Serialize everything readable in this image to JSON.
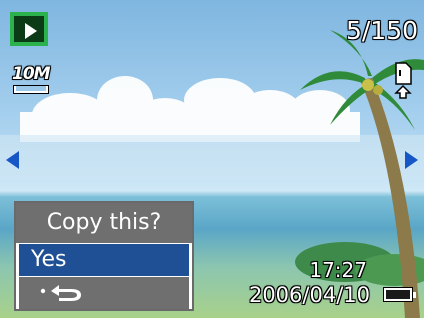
{
  "status": {
    "mode_icon": "play-mode-icon",
    "resolution_label": "10M",
    "counter": "5/150",
    "memory_icon": "internal-memory-icon",
    "time": "17:27",
    "date": "2006/04/10",
    "battery_icon": "battery-icon"
  },
  "nav": {
    "left_icon": "left-arrow-icon",
    "right_icon": "right-arrow-icon",
    "accent": "#1656c6"
  },
  "copy_menu": {
    "title": "Copy this?",
    "items": [
      {
        "label": "Yes",
        "selected": true
      },
      {
        "label": "",
        "icon": "back-icon",
        "selected": false
      }
    ],
    "selected_color": "#1f4f95",
    "panel_color": "#6f6f6f"
  },
  "mode_color": "#2bb24c"
}
